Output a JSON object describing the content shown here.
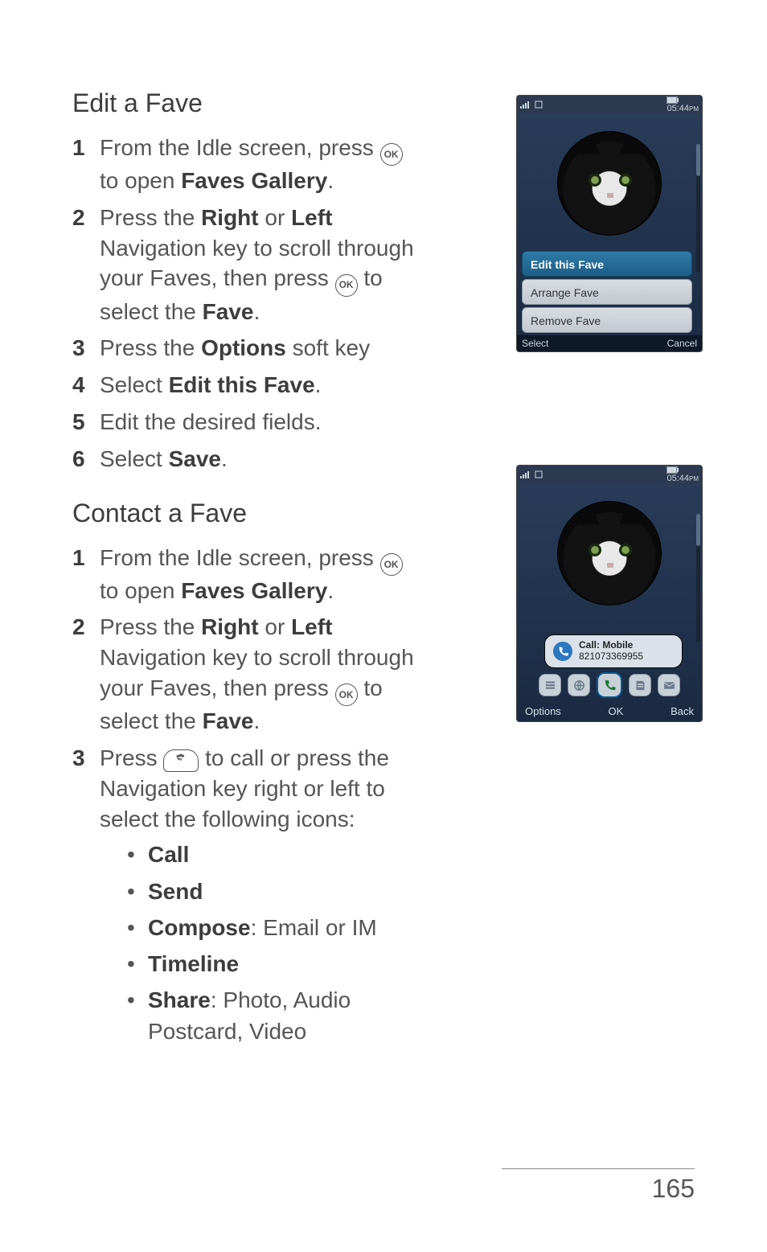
{
  "section1": {
    "heading": "Edit a Fave",
    "steps": {
      "s1a": "From the Idle screen, press ",
      "s1b": " to open ",
      "s1c": "Faves Gallery",
      "s1d": ".",
      "s2a": "Press the ",
      "s2right": "Right",
      "s2or": " or ",
      "s2left": "Left",
      "s2b": " Navigation key to scroll through your Faves, then press ",
      "s2c": " to select the ",
      "s2fave": "Fave",
      "s2d": ".",
      "s3a": "Press the ",
      "s3opt": "Options",
      "s3b": " soft key",
      "s4a": "Select ",
      "s4b": "Edit this Fave",
      "s4c": ".",
      "s5": "Edit the desired fields.",
      "s6a": "Select ",
      "s6b": "Save",
      "s6c": "."
    }
  },
  "section2": {
    "heading": "Contact a Fave",
    "steps": {
      "s1a": "From the Idle screen, press ",
      "s1b": " to open ",
      "s1c": "Faves Gallery",
      "s1d": ".",
      "s2a": "Press the ",
      "s2right": "Right",
      "s2or": " or ",
      "s2left": "Left",
      "s2b": " Navigation key to scroll through your Faves, then press ",
      "s2c": " to select the ",
      "s2fave": "Fave",
      "s2d": ".",
      "s3a": "Press ",
      "s3b": " to call or press the Navigation key right or left to select the following icons:"
    },
    "bullets": {
      "b1": "Call",
      "b2": "Send",
      "b3a": "Compose",
      "b3b": ": Email or IM",
      "b4": "Timeline",
      "b5a": "Share",
      "b5b": ": Photo, Audio Postcard, Video"
    }
  },
  "phone1": {
    "time": "05:44",
    "ampm": "PM",
    "menu": {
      "edit": "Edit this Fave",
      "arrange": "Arrange Fave",
      "remove": "Remove Fave"
    },
    "soft_left": "Select",
    "soft_right": "Cancel"
  },
  "phone2": {
    "time": "05:44",
    "ampm": "PM",
    "call_label": "Call:  Mobile",
    "call_number": "821073369955",
    "soft_left": "Options",
    "soft_mid": "OK",
    "soft_right": "Back"
  },
  "keys": {
    "ok": "OK"
  },
  "page_number": "165"
}
